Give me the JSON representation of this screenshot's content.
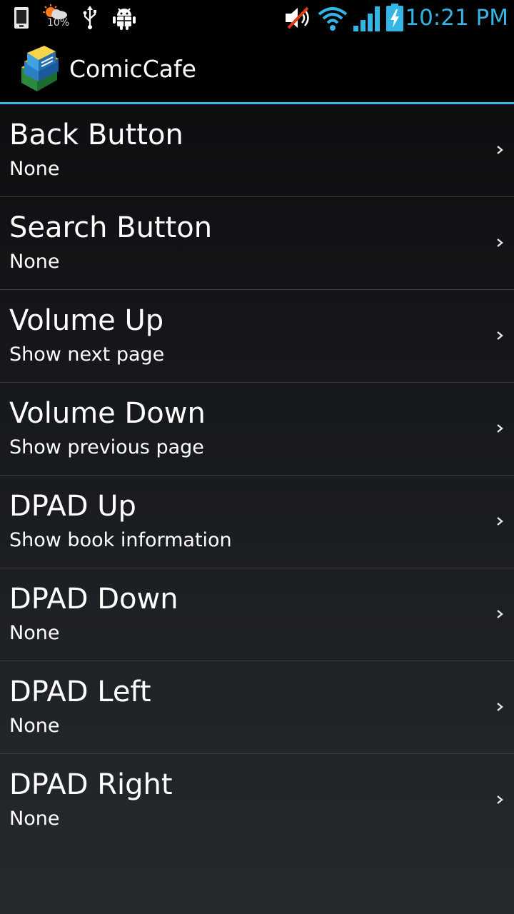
{
  "status_bar": {
    "time": "10:21 PM",
    "weather_text": "10%",
    "accent_color": "#33b5e5",
    "icons": [
      "phone-icon",
      "weather-icon",
      "usb-icon",
      "android-debug-icon",
      "mute-icon",
      "wifi-icon",
      "signal-icon",
      "battery-charging-icon"
    ]
  },
  "action_bar": {
    "title": "ComicCafe",
    "icon": "comiccafe-books-icon"
  },
  "preferences": [
    {
      "title": "Back Button",
      "summary": "None"
    },
    {
      "title": "Search Button",
      "summary": "None"
    },
    {
      "title": "Volume Up",
      "summary": "Show next page"
    },
    {
      "title": "Volume Down",
      "summary": "Show previous page"
    },
    {
      "title": "DPAD Up",
      "summary": "Show book information"
    },
    {
      "title": "DPAD Down",
      "summary": "None"
    },
    {
      "title": "DPAD Left",
      "summary": "None"
    },
    {
      "title": "DPAD Right",
      "summary": "None"
    }
  ]
}
